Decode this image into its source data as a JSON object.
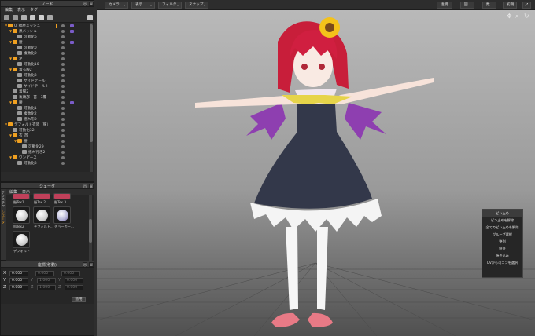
{
  "node_panel": {
    "title": "ノード",
    "menu": [
      "編集",
      "表示",
      "タグ"
    ],
    "nodes": [
      {
        "label": "U_福原メッシュ",
        "arrow": "▼",
        "badge": true,
        "orange": true
      },
      {
        "label": "黒メッシュ",
        "arrow": "▼",
        "badge": true
      },
      {
        "label": "可動化6",
        "arrow": "",
        "badge": false
      },
      {
        "label": "腰",
        "arrow": "▼",
        "badge": true
      },
      {
        "label": "可動化0",
        "arrow": "",
        "badge": false
      },
      {
        "label": "複数化0",
        "arrow": "",
        "badge": false
      },
      {
        "label": "足",
        "arrow": "▼",
        "badge": false
      },
      {
        "label": "可動化10",
        "arrow": "",
        "badge": false
      },
      {
        "label": "着る服2",
        "arrow": "▼",
        "badge": false
      },
      {
        "label": "可動化3",
        "arrow": "",
        "badge": false
      },
      {
        "label": "サイドテール",
        "arrow": "",
        "badge": false
      },
      {
        "label": "サイドテール2",
        "arrow": "",
        "badge": false
      },
      {
        "label": "着服2",
        "arrow": "",
        "badge": false
      },
      {
        "label": "後頭部・首・3覆",
        "arrow": "",
        "badge": false
      },
      {
        "label": "腰",
        "arrow": "▼",
        "badge": true
      },
      {
        "label": "可動化1",
        "arrow": "",
        "badge": false
      },
      {
        "label": "複数化2",
        "arrow": "",
        "badge": false
      },
      {
        "label": "揺れ形0",
        "arrow": "",
        "badge": false
      },
      {
        "label": "デフォルト衣装（服）",
        "arrow": "▼",
        "badge": false
      },
      {
        "label": "可動化32",
        "arrow": "",
        "badge": false
      },
      {
        "label": "衣_首",
        "arrow": "▼",
        "badge": false
      },
      {
        "label": "腰",
        "arrow": "▼",
        "badge": false
      },
      {
        "label": "可動化29",
        "arrow": "",
        "badge": false
      },
      {
        "label": "揺れ行き2",
        "arrow": "",
        "badge": false
      },
      {
        "label": "ワンピース",
        "arrow": "▼",
        "badge": false
      },
      {
        "label": "可動化3",
        "arrow": "",
        "badge": false
      }
    ]
  },
  "shader_panel": {
    "title": "シェーダ",
    "side_tabs": [
      "テクスチャ",
      "シェーダ"
    ],
    "menu": [
      "編集",
      "表示"
    ],
    "items": [
      "髪Tex1",
      "髪Tex 2",
      "髪Tex 3",
      "肌Tex2",
      "デフォルト...",
      "チョーカー...",
      "デフォルト"
    ]
  },
  "coord_panel": {
    "title": "座標(移動)",
    "rows": [
      {
        "axis": "X",
        "v1": "0.000",
        "v2": "0.000",
        "v3": "0.000"
      },
      {
        "axis": "Y",
        "v1": "0.000",
        "v2": "1.000",
        "v3": "0.000"
      },
      {
        "axis": "Z",
        "v1": "0.000",
        "v2": "1.000",
        "v3": "0.000"
      }
    ],
    "row_letters": [
      "",
      "Y",
      "Z"
    ],
    "apply_label": "適用"
  },
  "toolbar": {
    "camera": "カメラ",
    "display": "表示",
    "filter": "フィルタ",
    "snap": "スナップ",
    "right_buttons": [
      "透明",
      "回",
      "数",
      "初期"
    ]
  },
  "context_menu": {
    "items": [
      "ピン止め",
      "ピン止めを解除",
      "全てのピン止めを解除",
      "グループ選択",
      "整列",
      "結合",
      "焼き込み",
      "UVから可ゴンを選択"
    ],
    "selected_index": 0
  },
  "colors": {
    "accent": "#f0a020",
    "badge": "#7a5cc8",
    "panel_bg": "#2a2a2a"
  }
}
